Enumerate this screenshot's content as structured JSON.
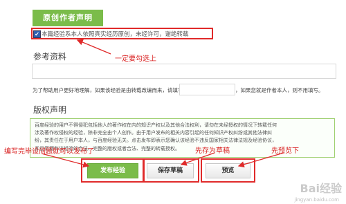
{
  "header": {
    "title": "原创作者声明"
  },
  "original_checkbox": {
    "checked": true,
    "check_glyph": "✔",
    "label": "本篇经验系本人依照真实经历原创，未经许可，谢绝转载"
  },
  "reference": {
    "title": "参考资料",
    "input_value": "",
    "help_before": "为了帮助用户更好地理解，如果该经验是由转载改编而来，请填写",
    "help_after": "，如果您就是作者本人，则不用填写。"
  },
  "copyright": {
    "title": "版权声明",
    "lines": [
      "百度经验的用户不得侵犯包括他人的著作权在内的知识产权以及其他合法权利，请勿在未经授权的情况下转载任何",
      "涉及著作权侵权的经验，除非完全由个人创作。由于用户发布的相关内容引起的任何知识产权纠纷或其他法律纠",
      "纷，其责任在于用户本人，与百度经验无关。点击发布即表示您确认该经验不违反国家相关法律法规及经验协议，",
      "并且您拥有该经验的合法、完整的版权或者合法、完整的转载授权。"
    ]
  },
  "buttons": {
    "publish": "发布经验",
    "save_draft": "保存草稿",
    "preview": "预览"
  },
  "annotations": {
    "must_check": "一定要勾选上",
    "finish_publish": "编写完毕设问题就可以发布了",
    "save_draft_first": "先存为草稿",
    "preview_first": "先预览下"
  },
  "colors": {
    "accent_green": "#7bbc4a",
    "annotation_red": "#e02a2a"
  },
  "watermark": {
    "brand": "Bai经验",
    "url": "jingyan.baidu.com"
  }
}
